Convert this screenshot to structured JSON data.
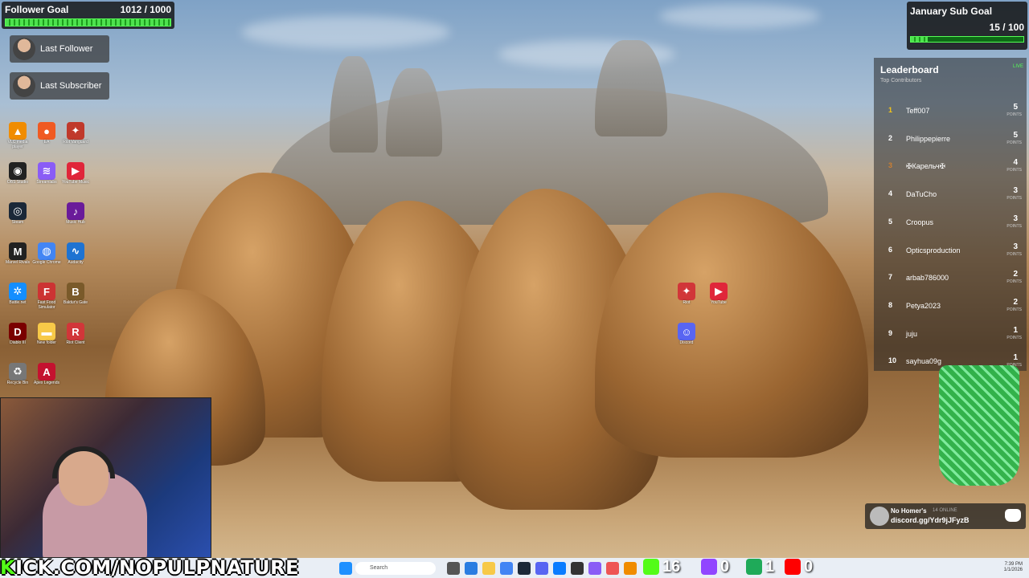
{
  "follower_goal": {
    "label": "Follower Goal",
    "value": "1012 / 1000",
    "progress": 1.0
  },
  "last_follower": {
    "label": "Last Follower"
  },
  "last_subscriber": {
    "label": "Last Subscriber"
  },
  "sub_goal": {
    "label": "January Sub Goal",
    "value": "15 / 100",
    "progress": 0.15
  },
  "leaderboard": {
    "title": "Leaderboard",
    "subtitle": "Top Contributors",
    "live": "LIVE",
    "points_label": "POINTS",
    "rows": [
      {
        "rank": "1",
        "name": "Teff007",
        "points": "5"
      },
      {
        "rank": "2",
        "name": "Philippepierre",
        "points": "5"
      },
      {
        "rank": "3",
        "name": "✠Карельч✠",
        "points": "4"
      },
      {
        "rank": "4",
        "name": "DaTuCho",
        "points": "3"
      },
      {
        "rank": "5",
        "name": "Croopus",
        "points": "3"
      },
      {
        "rank": "6",
        "name": "Opticsproduction",
        "points": "3"
      },
      {
        "rank": "7",
        "name": "arbab786000",
        "points": "2"
      },
      {
        "rank": "8",
        "name": "Petya2023",
        "points": "2"
      },
      {
        "rank": "9",
        "name": "juju",
        "points": "1"
      },
      {
        "rank": "10",
        "name": "sayhua09g",
        "points": "1"
      }
    ]
  },
  "desktop_icons": [
    {
      "name": "vlc-icon",
      "label": "VLC media player",
      "color": "#f08c00",
      "glyph": "▲"
    },
    {
      "name": "origin-icon",
      "label": "EA",
      "color": "#f05a22",
      "glyph": "●"
    },
    {
      "name": "riot-icon",
      "label": "Riot Vanguard",
      "color": "#c0392b",
      "glyph": "✦"
    },
    {
      "name": "obs-icon",
      "label": "OBS Studio",
      "color": "#222",
      "glyph": "◉"
    },
    {
      "name": "streamlabs-icon",
      "label": "Streamlabs",
      "color": "#8a5cf6",
      "glyph": "≋"
    },
    {
      "name": "youtube-music-icon",
      "label": "YouTube Music",
      "color": "#e0263a",
      "glyph": "▶"
    },
    {
      "name": "steam-icon",
      "label": "Steam",
      "color": "#1b2838",
      "glyph": "◎"
    },
    {
      "name": "music-hub-icon",
      "label": "Music Hub",
      "color": "#6a1b9a",
      "glyph": "♪"
    },
    {
      "name": "marvel-rivals-icon",
      "label": "Marvel Rivals",
      "color": "#222",
      "glyph": "M"
    },
    {
      "name": "chrome-icon",
      "label": "Google Chrome",
      "color": "#4285f4",
      "glyph": "◍"
    },
    {
      "name": "audacity-icon",
      "label": "Audacity",
      "color": "#1e73d2",
      "glyph": "∿"
    },
    {
      "name": "battlenet-icon",
      "label": "Battle.net",
      "color": "#148eff",
      "glyph": "✲"
    },
    {
      "name": "fast-food-icon",
      "label": "Fast Food Simulator",
      "color": "#c33",
      "glyph": "F"
    },
    {
      "name": "baldurs-gate-icon",
      "label": "Baldur's Gate",
      "color": "#7a5a2a",
      "glyph": "B"
    },
    {
      "name": "diablo-icon",
      "label": "Diablo III",
      "color": "#7a0000",
      "glyph": "D"
    },
    {
      "name": "folder-icon",
      "label": "New folder",
      "color": "#f7c948",
      "glyph": "▬"
    },
    {
      "name": "riot-client-icon",
      "label": "Riot Client",
      "color": "#d13639",
      "glyph": "R"
    },
    {
      "name": "recycle-icon",
      "label": "Recycle Bin",
      "color": "#777",
      "glyph": "♻"
    },
    {
      "name": "apex-icon",
      "label": "Apex Legends",
      "color": "#c4122f",
      "glyph": "A"
    }
  ],
  "center_icons": [
    {
      "name": "riot-game-icon",
      "label": "Riot",
      "color": "#d13639",
      "glyph": "✦"
    },
    {
      "name": "youtube-icon",
      "label": "YouTube",
      "color": "#e0263a",
      "glyph": "▶"
    },
    {
      "name": "discord-desktop-icon",
      "label": "Discord",
      "color": "#5865f2",
      "glyph": "☺"
    }
  ],
  "discord": {
    "name": "No Homer's",
    "online": "14 ONLINE",
    "link": "discord.gg/Ydr9jJFyzB"
  },
  "banner": {
    "k": "K",
    "rest": "ICK.COM/NOPULPNATURE"
  },
  "taskbar": {
    "search_placeholder": "Search"
  },
  "counters": [
    {
      "name": "kick-viewers",
      "value": "16",
      "color": "#53fc18"
    },
    {
      "name": "twitch-viewers",
      "value": "0",
      "color": "#9146ff"
    },
    {
      "name": "kick-followers",
      "value": "1",
      "color": "#1faa59"
    },
    {
      "name": "youtube-viewers",
      "value": "0",
      "color": "#ff0000"
    }
  ],
  "clock": {
    "time": "7:39 PM",
    "date": "1/1/2026"
  }
}
